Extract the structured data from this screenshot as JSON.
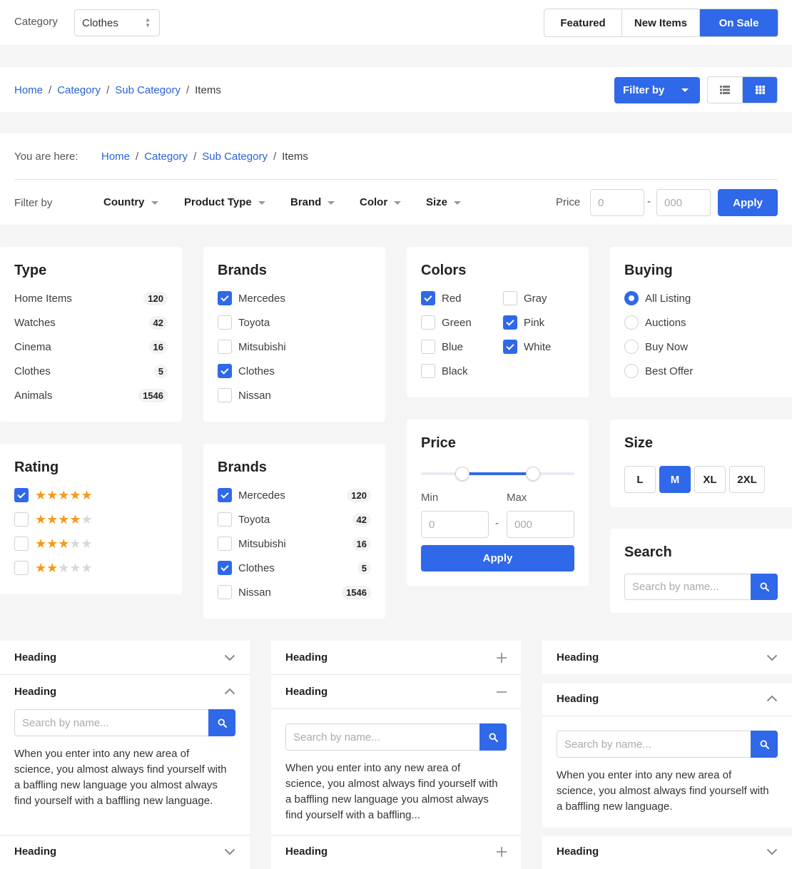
{
  "topbar": {
    "category_label": "Category",
    "category_value": "Clothes",
    "tabs": [
      "Featured",
      "New Items",
      "On Sale"
    ]
  },
  "bar2": {
    "breadcrumb": [
      "Home",
      "Category",
      "Sub Category",
      "Items"
    ],
    "filter_label": "Filter by"
  },
  "bar3": {
    "you_are_here": "You are here:",
    "breadcrumb": [
      "Home",
      "Category",
      "Sub Category",
      "Items"
    ],
    "filter_by": "Filter by",
    "filters": [
      "Country",
      "Product Type",
      "Brand",
      "Color",
      "Size"
    ],
    "price_label": "Price",
    "price_min_placeholder": "0",
    "price_max_placeholder": "000",
    "dash": "-",
    "apply": "Apply"
  },
  "type_card": {
    "title": "Type",
    "items": [
      {
        "label": "Home Items",
        "count": "120"
      },
      {
        "label": "Watches",
        "count": "42"
      },
      {
        "label": "Cinema",
        "count": "16"
      },
      {
        "label": "Clothes",
        "count": "5"
      },
      {
        "label": "Animals",
        "count": "1546"
      }
    ]
  },
  "brands_card": {
    "title": "Brands",
    "items": [
      {
        "label": "Mercedes",
        "checked": true
      },
      {
        "label": "Toyota",
        "checked": false
      },
      {
        "label": "Mitsubishi",
        "checked": false
      },
      {
        "label": "Clothes",
        "checked": true
      },
      {
        "label": "Nissan",
        "checked": false
      }
    ]
  },
  "colors_card": {
    "title": "Colors",
    "items": [
      {
        "label": "Red",
        "checked": true
      },
      {
        "label": "Gray",
        "checked": false
      },
      {
        "label": "Green",
        "checked": false
      },
      {
        "label": "Pink",
        "checked": true
      },
      {
        "label": "Blue",
        "checked": false
      },
      {
        "label": "White",
        "checked": true
      },
      {
        "label": "Black",
        "checked": false
      }
    ]
  },
  "buying_card": {
    "title": "Buying",
    "items": [
      {
        "label": "All Listing",
        "selected": true
      },
      {
        "label": "Auctions",
        "selected": false
      },
      {
        "label": "Buy Now",
        "selected": false
      },
      {
        "label": "Best Offer",
        "selected": false
      }
    ]
  },
  "rating_card": {
    "title": "Rating",
    "rows": [
      {
        "stars": 5,
        "checked": true
      },
      {
        "stars": 4,
        "checked": false
      },
      {
        "stars": 3,
        "checked": false
      },
      {
        "stars": 2,
        "checked": false
      }
    ]
  },
  "brands2_card": {
    "title": "Brands",
    "items": [
      {
        "label": "Mercedes",
        "count": "120",
        "checked": true
      },
      {
        "label": "Toyota",
        "count": "42",
        "checked": false
      },
      {
        "label": "Mitsubishi",
        "count": "16",
        "checked": false
      },
      {
        "label": "Clothes",
        "count": "5",
        "checked": true
      },
      {
        "label": "Nissan",
        "count": "1546",
        "checked": false
      }
    ]
  },
  "price_card": {
    "title": "Price",
    "min_label": "Min",
    "max_label": "Max",
    "min_placeholder": "0",
    "max_placeholder": "000",
    "dash": "-",
    "apply": "Apply",
    "range_low": 0.27,
    "range_high": 0.73
  },
  "size_card": {
    "title": "Size",
    "sizes": [
      "L",
      "M",
      "XL",
      "2XL"
    ],
    "selected": "M"
  },
  "search_card": {
    "title": "Search",
    "placeholder": "Search by name..."
  },
  "accordions": {
    "heading": "Heading",
    "placeholder": "Search by name...",
    "text1": "When you enter into any new area of science, you almost always find yourself with a baffling new language you almost always find yourself with a baffling new language.",
    "text2": "When you enter into any new area of science, you almost always find yourself with a baffling new language you almost always find yourself with a baffling...",
    "text3": "When you enter into any new area of science, you almost always find yourself with a baffling new language."
  },
  "colors": {
    "accent": "#2f68e8",
    "star": "#f59a1a"
  }
}
